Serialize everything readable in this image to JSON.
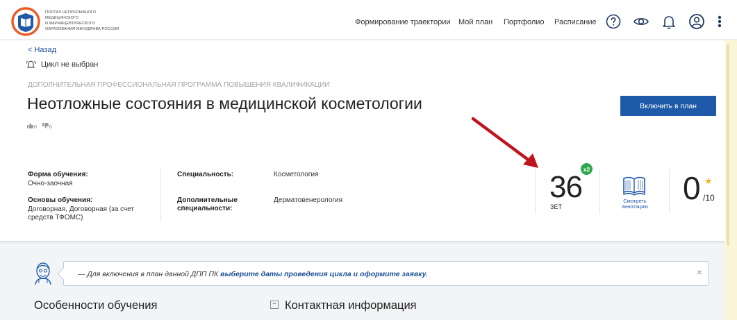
{
  "header": {
    "logo_lines": [
      "Портал непрерывного",
      "медицинского",
      "и фармацевтического",
      "образования Минздрава России"
    ],
    "nav": [
      "Формирование траектории",
      "Мой план",
      "Портфолио",
      "Расписание"
    ],
    "icons": [
      "help-icon",
      "eye-icon",
      "bell-icon",
      "user-icon",
      "more-icon"
    ]
  },
  "page": {
    "back_label": "< Назад",
    "cycle_label": "Цикл не выбран",
    "program_type": "Дополнительная профессиональная программа повышения квалификации",
    "title": "Неотложные состояния в медицинской косметологии",
    "likes": "0",
    "dislikes": "0",
    "include_button": "Включить в план"
  },
  "info": {
    "form_label": "Форма обучения:",
    "form_value": "Очно-заочная",
    "basis_label": "Основы обучения:",
    "basis_value": "Договорная, Договорная (за счет средств ТФОМС)",
    "specialty_label": "Специальность:",
    "specialty_value": "Косметология",
    "extra_specialty_label": "Дополнительные специальности:",
    "extra_specialty_value": "Дерматовенерология"
  },
  "stats": {
    "zet_value": "36",
    "zet_label": "ЗЕТ",
    "zet_multiplier": "x2",
    "annotation_label": "Смотреть аннотацию",
    "rating_value": "0",
    "rating_max": "/10"
  },
  "notice": {
    "prefix": "— Для включения в план данной ДПП ПК ",
    "link": "выберите даты проведения цикла и оформите заявку.",
    "close": "×"
  },
  "sections": {
    "features_title": "Особенности обучения",
    "contacts_title": "Контактная информация",
    "contacts_toggle": "−"
  },
  "colors": {
    "primary": "#1e5aa8",
    "accent_orange": "#e85d26",
    "badge_green": "#2fa84f",
    "star": "#f1b31c",
    "annotation_arrow": "#c0141c"
  }
}
